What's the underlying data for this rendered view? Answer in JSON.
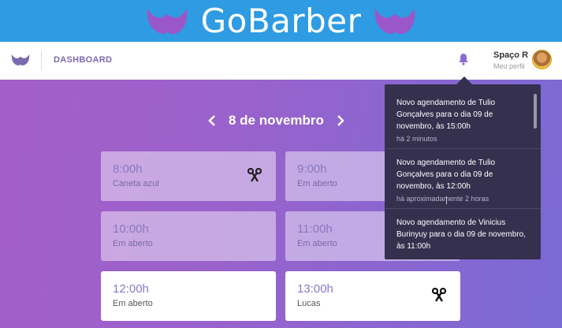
{
  "brand": {
    "title": "GoBarber"
  },
  "header": {
    "nav_title": "DASHBOARD",
    "user_name": "Spaço R",
    "user_sub": "Meu perfil"
  },
  "date_nav": {
    "label": "8 de novembro"
  },
  "slots": [
    {
      "time": "8:00h",
      "who": "Caneta azul"
    },
    {
      "time": "9:00h",
      "who": "Em aberto"
    },
    {
      "time": "10:00h",
      "who": "Em aberto"
    },
    {
      "time": "11:00h",
      "who": "Em aberto"
    },
    {
      "time": "12:00h",
      "who": "Em aberto"
    },
    {
      "time": "13:00h",
      "who": "Lucas"
    }
  ],
  "notifications": [
    {
      "msg": "Novo agendamento de Tulio Gonçalves para o dia 09 de novembro, às 15:00h",
      "age": "há 2 minutos"
    },
    {
      "msg": "Novo agendamento de Tulio Gonçalves para o dia 09 de novembro, às 12:00h",
      "age": "há aproximadamente 2 horas"
    },
    {
      "msg": "Novo agendamento de Vinicius Burinyuy para o dia 09 de novembro, às 11:00h",
      "age": ""
    }
  ],
  "colors": {
    "brand_bar": "#2e9be3",
    "accent": "#7b6ab0",
    "popover": "#34304e"
  },
  "icons": [
    "mustache-icon",
    "bell-icon",
    "chevron-left-icon",
    "chevron-right-icon",
    "scissors-icon"
  ]
}
